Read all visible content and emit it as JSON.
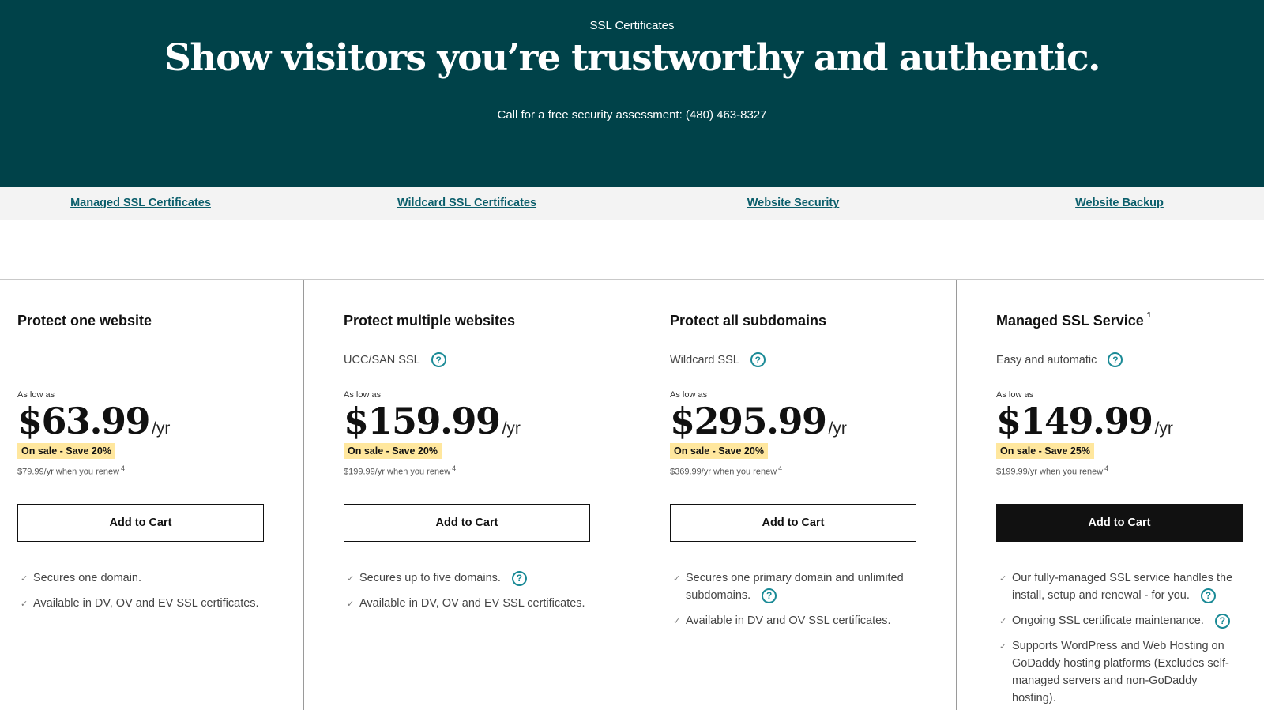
{
  "hero": {
    "eyebrow": "SSL Certificates",
    "title": "Show visitors you’re trustworthy and authentic.",
    "phone_text": "Call for a free security assessment: (480) 463-8327"
  },
  "subnav": [
    {
      "label": "Managed SSL Certificates"
    },
    {
      "label": "Wildcard SSL Certificates"
    },
    {
      "label": "Website Security"
    },
    {
      "label": "Website Backup"
    }
  ],
  "cards": [
    {
      "title": "Protect one website",
      "subtitle": "",
      "as_low": "As low as",
      "price": "$63.99",
      "per": "/yr",
      "sale": "On sale - Save 20%",
      "renew": "$79.99/yr when you renew",
      "renew_note": "4",
      "cart": "Add to Cart",
      "features": [
        "Secures one domain.",
        "Available in DV, OV and EV SSL certificates."
      ]
    },
    {
      "title": "Protect multiple websites",
      "subtitle": "UCC/SAN SSL",
      "as_low": "As low as",
      "price": "$159.99",
      "per": "/yr",
      "sale": "On sale - Save 20%",
      "renew": "$199.99/yr when you renew",
      "renew_note": "4",
      "cart": "Add to Cart",
      "features": [
        "Secures up to five domains.",
        "Available in DV, OV and EV SSL certificates."
      ]
    },
    {
      "title": "Protect all subdomains",
      "subtitle": "Wildcard SSL",
      "as_low": "As low as",
      "price": "$295.99",
      "per": "/yr",
      "sale": "On sale - Save 20%",
      "renew": "$369.99/yr when you renew",
      "renew_note": "4",
      "cart": "Add to Cart",
      "features": [
        "Secures one primary domain and unlimited subdomains.",
        "Available in DV and OV SSL certificates."
      ]
    },
    {
      "title": "Managed SSL Service",
      "title_note": "1",
      "subtitle": "Easy and automatic",
      "as_low": "As low as",
      "price": "$149.99",
      "per": "/yr",
      "sale": "On sale - Save 25%",
      "renew": "$199.99/yr when you renew",
      "renew_note": "4",
      "cart": "Add to Cart",
      "features": [
        "Our fully-managed SSL service handles the install, setup and renewal - for you.",
        "Ongoing SSL certificate maintenance.",
        "Supports WordPress and Web Hosting on GoDaddy hosting platforms (Excludes self-managed servers and non-GoDaddy hosting)."
      ]
    }
  ],
  "icons": {
    "help": "question-circle-icon",
    "check": "check-icon"
  },
  "colors": {
    "hero_bg": "#004249",
    "link": "#0b5e6b",
    "sale_bg": "#ffe79e",
    "primary_button": "#111111",
    "help_icon": "#1a8a96"
  }
}
